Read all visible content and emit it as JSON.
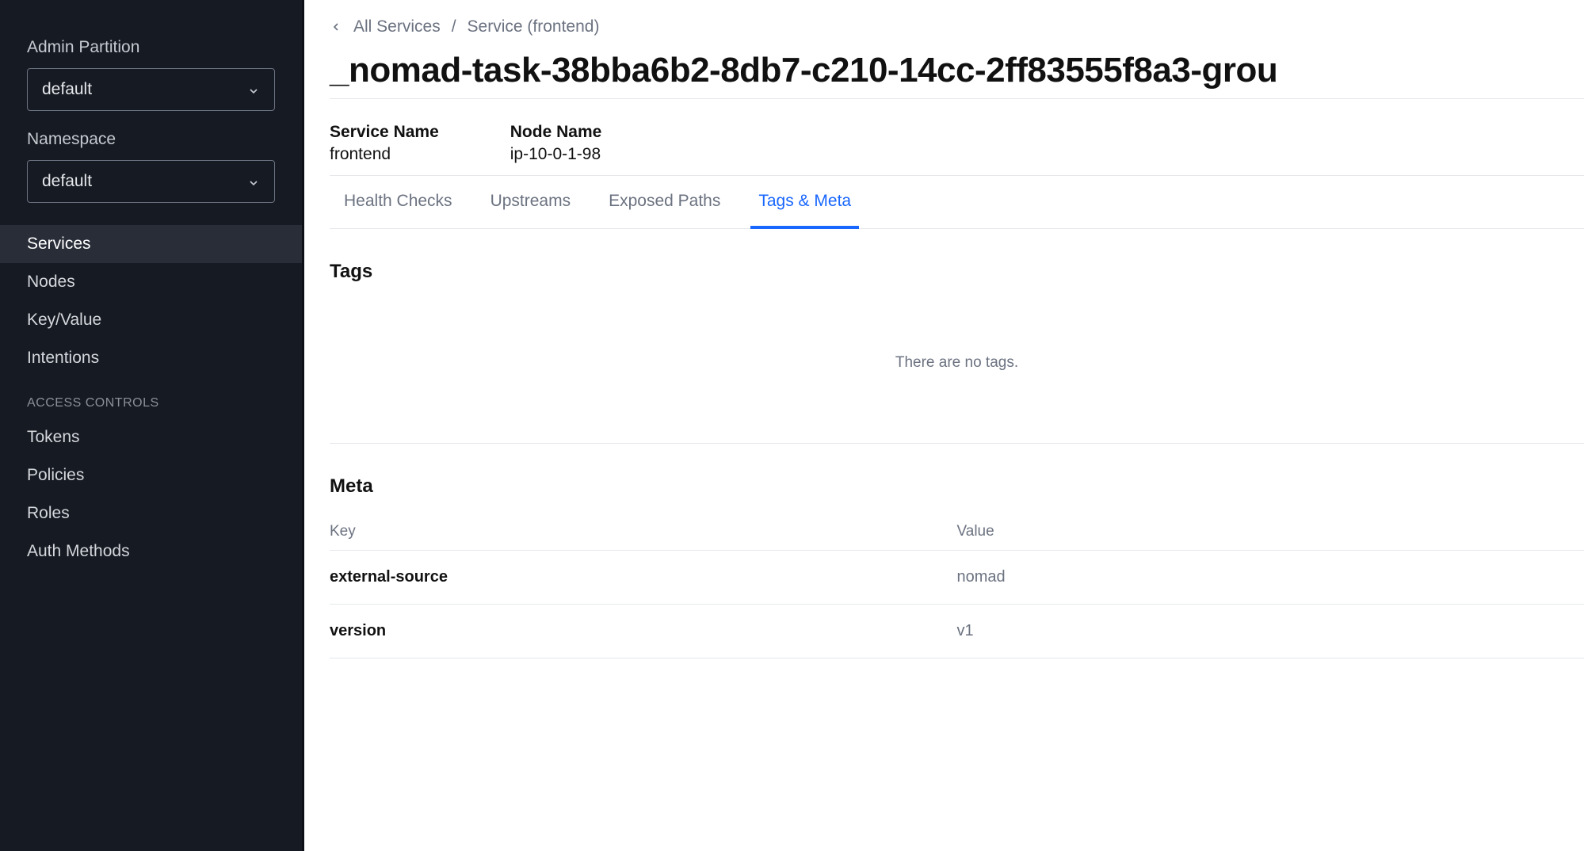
{
  "sidebar": {
    "partition_label": "Admin Partition",
    "partition_value": "default",
    "namespace_label": "Namespace",
    "namespace_value": "default",
    "nav": [
      {
        "label": "Services",
        "active": true
      },
      {
        "label": "Nodes",
        "active": false
      },
      {
        "label": "Key/Value",
        "active": false
      },
      {
        "label": "Intentions",
        "active": false
      }
    ],
    "access_controls_label": "ACCESS CONTROLS",
    "access_nav": [
      {
        "label": "Tokens"
      },
      {
        "label": "Policies"
      },
      {
        "label": "Roles"
      },
      {
        "label": "Auth Methods"
      }
    ]
  },
  "breadcrumb": {
    "items": [
      "All Services",
      "Service (frontend)"
    ],
    "separator": "/"
  },
  "page_title": "_nomad-task-38bba6b2-8db7-c210-14cc-2ff83555f8a3-grou",
  "info": {
    "service_name_label": "Service Name",
    "service_name_value": "frontend",
    "node_name_label": "Node Name",
    "node_name_value": "ip-10-0-1-98"
  },
  "tabs": [
    {
      "label": "Health Checks",
      "active": false
    },
    {
      "label": "Upstreams",
      "active": false
    },
    {
      "label": "Exposed Paths",
      "active": false
    },
    {
      "label": "Tags & Meta",
      "active": true
    }
  ],
  "tags_section": {
    "title": "Tags",
    "empty_message": "There are no tags."
  },
  "meta_section": {
    "title": "Meta",
    "key_header": "Key",
    "value_header": "Value",
    "rows": [
      {
        "key": "external-source",
        "value": "nomad"
      },
      {
        "key": "version",
        "value": "v1"
      }
    ]
  }
}
